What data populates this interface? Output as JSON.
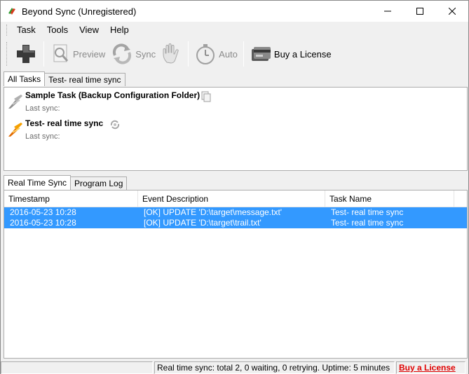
{
  "window": {
    "title": "Beyond Sync (Unregistered)"
  },
  "menu": [
    "Task",
    "Tools",
    "View",
    "Help"
  ],
  "toolbar": {
    "buttons": [
      {
        "label": "",
        "icon": "add-icon",
        "enabled": true
      },
      {
        "label": "Preview",
        "icon": "preview-icon",
        "enabled": false
      },
      {
        "label": "Sync",
        "icon": "sync-icon",
        "enabled": false
      },
      {
        "label": "",
        "icon": "stop-hand-icon",
        "enabled": false
      },
      {
        "label": "Auto",
        "icon": "auto-timer-icon",
        "enabled": false
      },
      {
        "label": "Buy a License",
        "icon": "license-card-icon",
        "enabled": true
      }
    ]
  },
  "task_tabs": [
    "All Tasks",
    "Test- real time sync"
  ],
  "tasks": [
    {
      "name": "Sample Task (Backup Configuration Folder)",
      "last_sync": "Last sync:",
      "state_icon": "copy-icon",
      "icon_color": "#909090"
    },
    {
      "name": "Test- real time sync",
      "last_sync": "Last sync:",
      "state_icon": "sync-small-icon",
      "icon_color": "#e06a00"
    }
  ],
  "log_tabs": [
    "Real Time Sync",
    "Program Log"
  ],
  "log": {
    "columns": [
      "Timestamp",
      "Event Description",
      "Task Name"
    ],
    "rows": [
      {
        "timestamp": "2016-05-23 10:28",
        "event": "[OK] UPDATE 'D:\\target\\message.txt'",
        "task": "Test- real time sync"
      },
      {
        "timestamp": "2016-05-23 10:28",
        "event": "[OK] UPDATE 'D:\\target\\trail.txt'",
        "task": "Test- real time sync"
      }
    ]
  },
  "status": {
    "message": "Real time sync: total 2, 0 waiting, 0 retrying. Uptime:  5 minutes",
    "link": "Buy a License"
  },
  "colors": {
    "selection": "#3399ff",
    "link": "#e00000"
  }
}
